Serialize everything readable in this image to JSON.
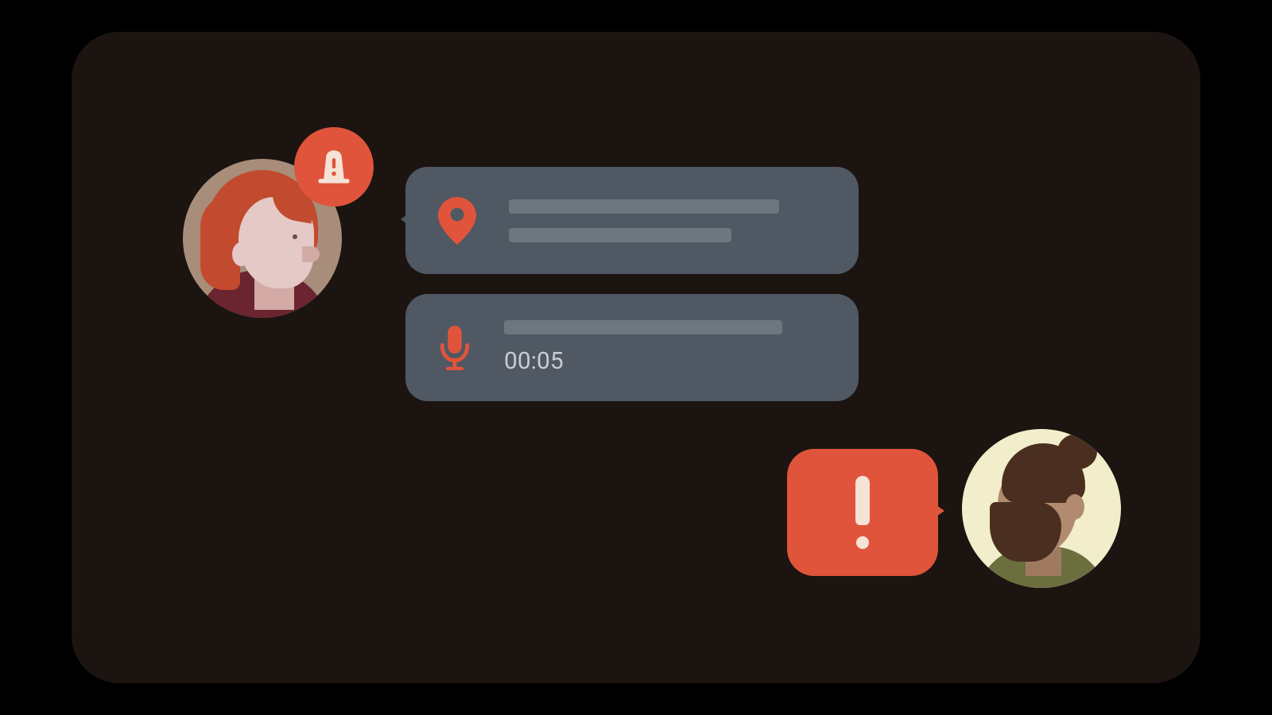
{
  "audio": {
    "duration": "00:05"
  },
  "alert": {
    "symbol": "!"
  },
  "colors": {
    "accent": "#e0543c",
    "bubble": "#4f5863",
    "panel": "#1b1410"
  }
}
